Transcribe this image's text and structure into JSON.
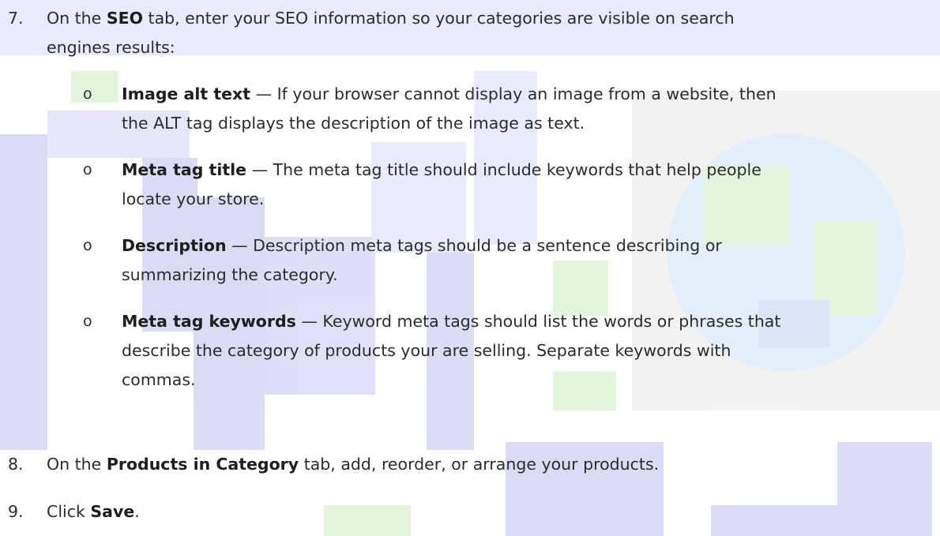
{
  "steps": {
    "s7": {
      "number": "7.",
      "pre": "On the ",
      "bold": "SEO",
      "post_line1": " tab, enter your SEO information so your categories are visible on search",
      "post_line2": "engines results:"
    },
    "bullet_symbol": "o",
    "bullets": [
      {
        "bold": "Image alt text",
        "line1": " — If your browser cannot display an image from a website, then",
        "line2": "the ALT tag displays the description of the image as text."
      },
      {
        "bold": "Meta tag title",
        "line1": " — The meta tag title should include keywords that help people",
        "line2": "locate your store."
      },
      {
        "bold": "Description",
        "line1": " — Description meta tags should be a sentence describing or",
        "line2": "summarizing the category."
      },
      {
        "bold": "Meta tag keywords",
        "line1": " — Keyword meta tags should list the words or phrases that",
        "line2": "describe the category of products your are selling. Separate keywords with",
        "line3": "commas."
      }
    ],
    "s8": {
      "number": "8.",
      "pre": "On the ",
      "bold": "Products in Category",
      "post": " tab, add, reorder, or arrange your products."
    },
    "s9": {
      "number": "9.",
      "pre": "Click ",
      "bold": "Save",
      "post": "."
    }
  },
  "colors": {
    "text": "#2b2b2b",
    "watermark_blue": "#5b5fd6",
    "watermark_green": "#7fd66a"
  }
}
